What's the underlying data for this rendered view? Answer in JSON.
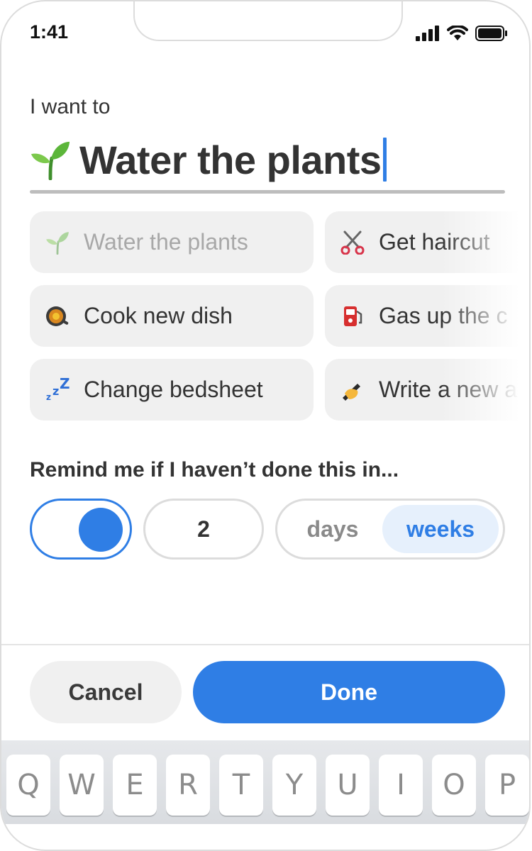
{
  "status": {
    "time": "1:41"
  },
  "form": {
    "want_label": "I want to",
    "task_title": "Water the plants"
  },
  "suggestions": [
    {
      "label": "Water the plants",
      "icon": "seedling-icon",
      "dimmed": true
    },
    {
      "label": "Get haircut",
      "icon": "scissors-icon",
      "dimmed": false
    },
    {
      "label": "Cook new dish",
      "icon": "cooking-pan-icon",
      "dimmed": false
    },
    {
      "label": "Gas up the c",
      "icon": "fuel-pump-icon",
      "dimmed": false
    },
    {
      "label": "Change bedsheet",
      "icon": "sleeping-zzz-icon",
      "dimmed": false
    },
    {
      "label": "Write a new a",
      "icon": "writing-hand-icon",
      "dimmed": false
    }
  ],
  "reminder": {
    "label": "Remind me if I haven’t done this in...",
    "enabled": true,
    "count": "2",
    "units": [
      "days",
      "weeks"
    ],
    "selected_unit": "weeks"
  },
  "actions": {
    "cancel": "Cancel",
    "done": "Done"
  },
  "keyboard": {
    "keys": [
      "Q",
      "W",
      "E",
      "R",
      "T",
      "Y",
      "U",
      "I",
      "O",
      "P"
    ]
  },
  "colors": {
    "accent": "#2f7ee5",
    "chip_bg": "#f0f0f0",
    "selected_bg": "#e6f0fc"
  }
}
